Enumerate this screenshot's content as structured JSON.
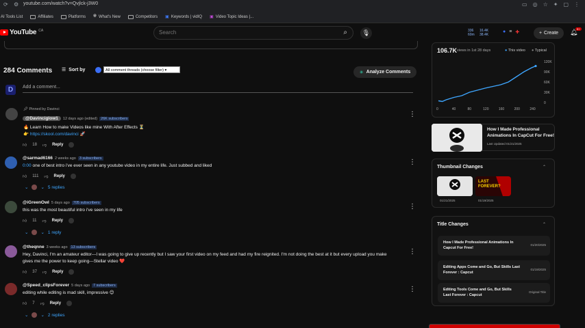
{
  "browser": {
    "url": "youtube.com/watch?v=Qvjlck-j3W0",
    "bookmarks": [
      "AI Tools List",
      "Affiliates",
      "Platforms",
      "What's New",
      "Competitors",
      "Keywords | vidIQ",
      "Video Topic Ideas |..."
    ]
  },
  "header": {
    "logo_text": "YouTube",
    "logo_sup": "CA",
    "search_placeholder": "Search",
    "mini_stats": [
      "336",
      "60m"
    ],
    "mini_stats2": [
      "16.4K",
      "38.4K"
    ],
    "create_label": "Create",
    "notif_count": "9+",
    "colors": {
      "brand": "#ff0000",
      "accent": "#3ea6ff"
    }
  },
  "comments": {
    "count_label": "284 Comments",
    "sort_label": "Sort by",
    "filter_value": "All comment threads (choose filter)",
    "analyze_label": "Analyze Comments",
    "add_placeholder": "Add a comment...",
    "items": [
      {
        "pinned": "Pinned by Davinci",
        "author": "@Davinciglow1",
        "meta": "12 days ago (edited)",
        "subs": "26K subscribers",
        "lines": [
          "🔥 Learn How to make Videos like mine With After Effects ⏳",
          "👉 https://skool.com/davinci 🚀"
        ],
        "link": "https://skool.com/davinci",
        "likes": "18",
        "reply": "Reply"
      },
      {
        "author": "@sarmad6166",
        "meta": "2 weeks ago",
        "subs": "3 subscribers",
        "time_link": "0:00",
        "text": "one of best intro i've ever seen in any youtube video in my entire life. Just subbed and liked",
        "likes": "111",
        "reply": "Reply",
        "replies": "5 replies"
      },
      {
        "author": "@iGreenOwl",
        "meta": "5 days ago",
        "subs": "705 subscribers",
        "text": "this was the most beautiful intro i've seen in my life",
        "likes": "11",
        "reply": "Reply",
        "replies": "1 reply"
      },
      {
        "author": "@theqnne",
        "meta": "3 weeks ago",
        "subs": "13 subscribers",
        "text1": "Hey, Davinci, I'm an amateur editor---I was going to give up  recently but I saw your first video on my feed and had my fire reignited. I'm not doing the best at it but every upload you make",
        "text2": "gives me the power to keep going---Stellar video ❤️",
        "likes": "37",
        "reply": "Reply"
      },
      {
        "author": "@Speed_clipsForever",
        "meta": "5 days ago",
        "subs": "7 subscribers",
        "text": "editing while editing is mad skill, impressive 😊",
        "likes": "7",
        "reply": "Reply",
        "replies": "2 replies"
      }
    ]
  },
  "sidebar": {
    "views_big": "106.7K",
    "views_small": "views in 1st 28 days",
    "legend_this": "This video",
    "legend_typical": "Typical",
    "video_title": "How I Made Professional Animations In CapCut For Free!",
    "video_updated": "Last Updated 01/21/2025",
    "thumb_changes_title": "Thumbnail Changes",
    "thumb_dates": [
      "01/21/2025",
      "01/19/2025"
    ],
    "thumb2_text": "LAST FOREVER?",
    "title_changes_title": "Title Changes",
    "title_changes": [
      {
        "title": "How I Made Professional Animations In Capcut For Free!",
        "date": "01/20/2025"
      },
      {
        "title": "Editing Apps Come and Go, But Skills Last Forever : Capcut",
        "date": "01/19/2025"
      },
      {
        "title": "Editing Tools Come and Go, But Skills Last Forever : Capcut",
        "date": "Original Title"
      }
    ]
  },
  "chart_data": {
    "type": "line",
    "x_ticks": [
      "0",
      "40",
      "80",
      "120",
      "160",
      "200",
      "240"
    ],
    "y_ticks": [
      "0",
      "30K",
      "60K",
      "90K",
      "120K"
    ],
    "ylim": [
      0,
      120000
    ],
    "xlim": [
      0,
      250
    ],
    "series": [
      {
        "name": "This video",
        "color": "#3ea6ff",
        "x": [
          0,
          10,
          20,
          40,
          60,
          80,
          100,
          120,
          140,
          160,
          180,
          200,
          220,
          240,
          250
        ],
        "y": [
          5000,
          3000,
          8000,
          15000,
          20000,
          30000,
          36000,
          42000,
          47000,
          52000,
          60000,
          75000,
          90000,
          102000,
          106700
        ]
      }
    ]
  }
}
